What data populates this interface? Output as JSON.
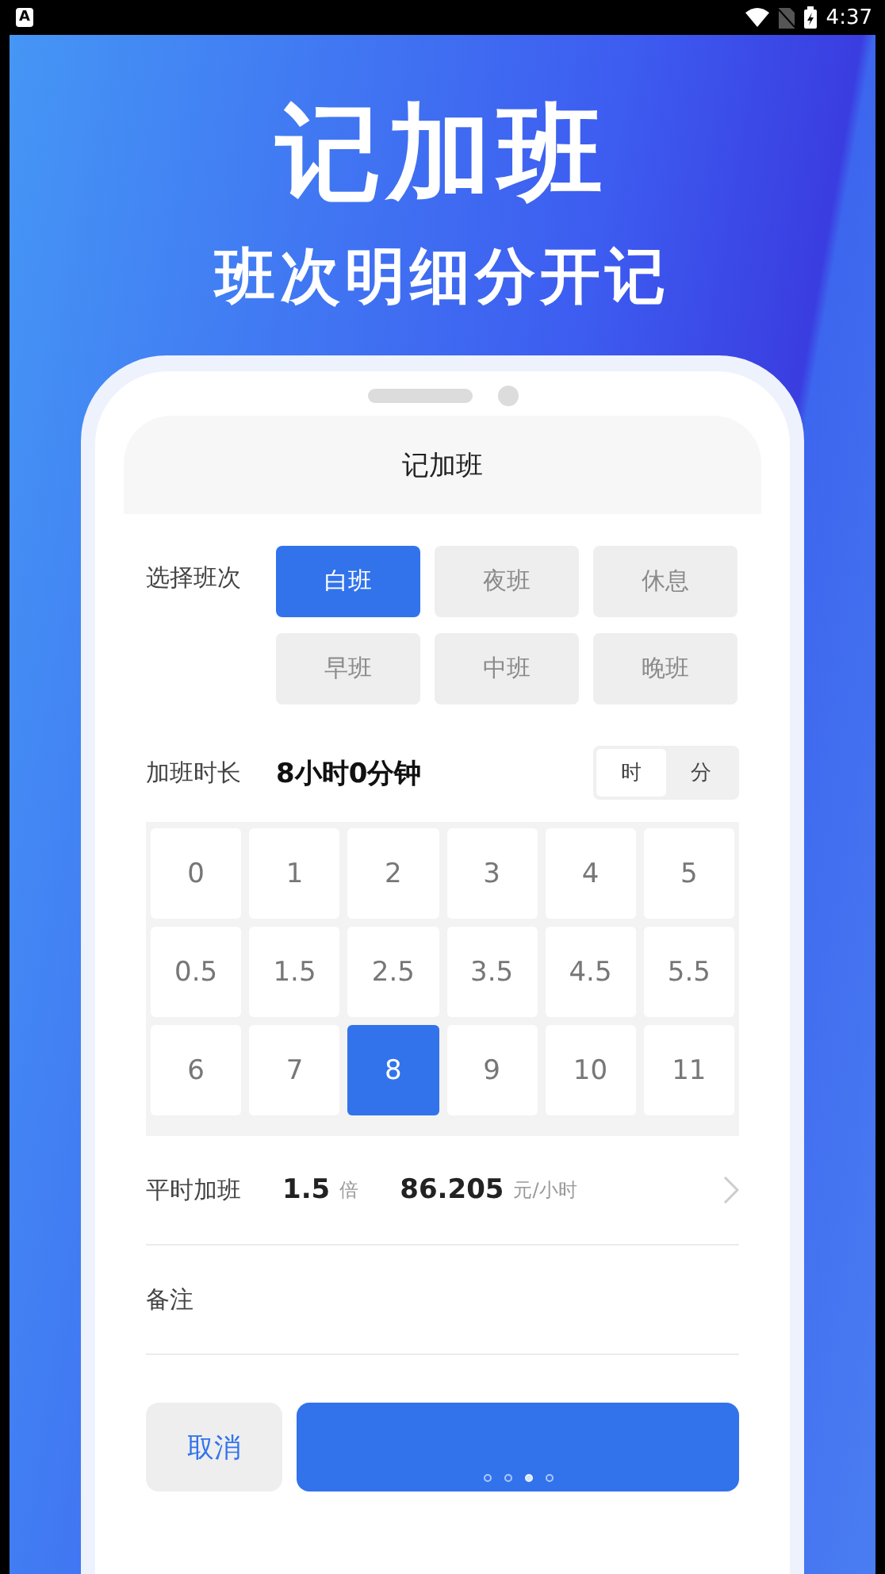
{
  "status_bar": {
    "app_badge": "A",
    "time": "4:37"
  },
  "hero": {
    "title": "记加班",
    "subtitle": "班次明细分开记"
  },
  "screen": {
    "title": "记加班",
    "shift": {
      "label": "选择班次",
      "options": [
        {
          "label": "白班",
          "selected": true
        },
        {
          "label": "夜班",
          "selected": false
        },
        {
          "label": "休息",
          "selected": false
        },
        {
          "label": "早班",
          "selected": false
        },
        {
          "label": "中班",
          "selected": false
        },
        {
          "label": "晚班",
          "selected": false
        }
      ]
    },
    "duration": {
      "label": "加班时长",
      "value": "8小时0分钟",
      "units": [
        {
          "label": "时",
          "selected": true
        },
        {
          "label": "分",
          "selected": false
        }
      ]
    },
    "hours": [
      {
        "label": "0",
        "selected": false
      },
      {
        "label": "1",
        "selected": false
      },
      {
        "label": "2",
        "selected": false
      },
      {
        "label": "3",
        "selected": false
      },
      {
        "label": "4",
        "selected": false
      },
      {
        "label": "5",
        "selected": false
      },
      {
        "label": "0.5",
        "selected": false
      },
      {
        "label": "1.5",
        "selected": false
      },
      {
        "label": "2.5",
        "selected": false
      },
      {
        "label": "3.5",
        "selected": false
      },
      {
        "label": "4.5",
        "selected": false
      },
      {
        "label": "5.5",
        "selected": false
      },
      {
        "label": "6",
        "selected": false
      },
      {
        "label": "7",
        "selected": false
      },
      {
        "label": "8",
        "selected": true
      },
      {
        "label": "9",
        "selected": false
      },
      {
        "label": "10",
        "selected": false
      },
      {
        "label": "11",
        "selected": false
      }
    ],
    "rate": {
      "label": "平时加班",
      "multiplier": "1.5",
      "multiplier_unit": "倍",
      "wage": "86.205",
      "wage_unit": "元/小时"
    },
    "note": {
      "label": "备注"
    },
    "cancel": "取消",
    "page_dots": [
      {
        "selected": false
      },
      {
        "selected": false
      },
      {
        "selected": true
      },
      {
        "selected": false
      }
    ]
  }
}
